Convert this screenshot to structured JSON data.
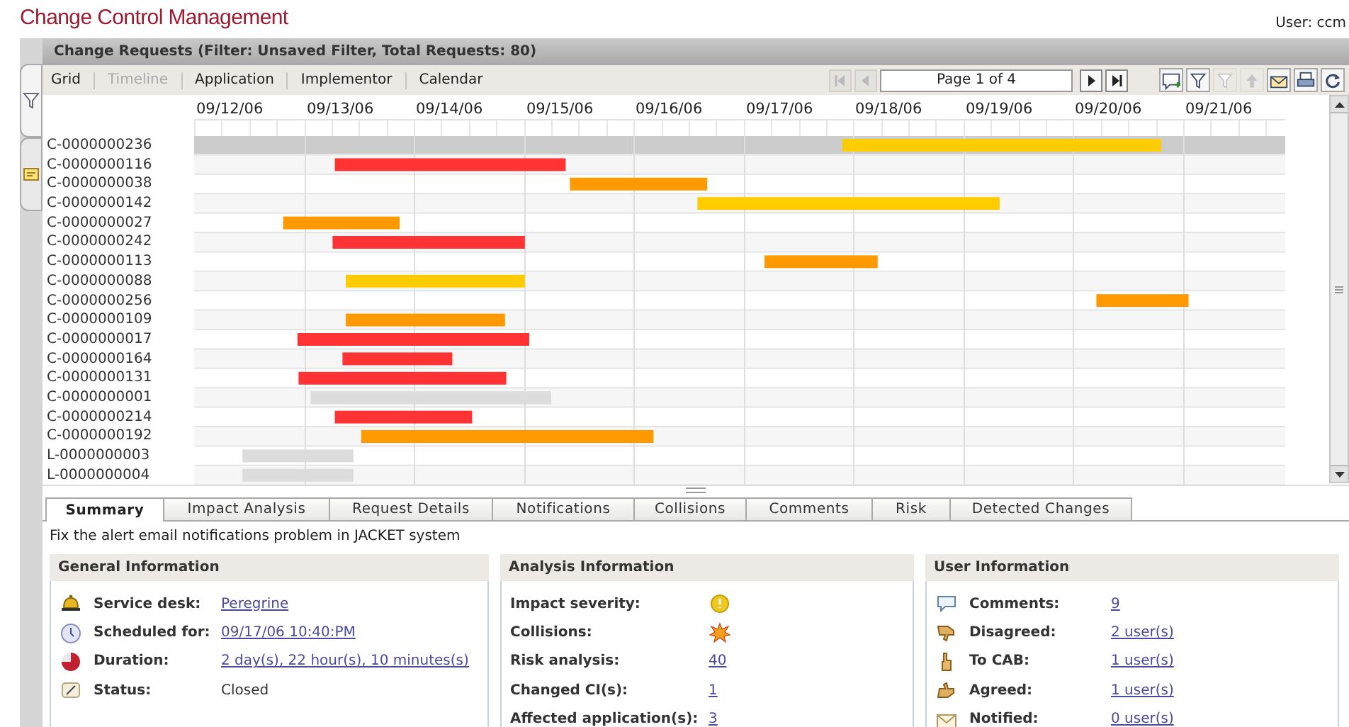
{
  "app_title": "Change Control Management",
  "user": "User: ccm",
  "side_tabs": [
    {
      "kind": "filter",
      "selected": true
    },
    {
      "kind": "note",
      "selected": false
    }
  ],
  "panel_title": "Change Requests (Filter: Unsaved Filter, Total Requests: 80)",
  "views": [
    {
      "label": "Grid",
      "selected": false
    },
    {
      "label": "Timeline",
      "selected": true
    },
    {
      "label": "Application",
      "selected": false
    },
    {
      "label": "Implementor",
      "selected": false
    },
    {
      "label": "Calendar",
      "selected": false
    }
  ],
  "pager": {
    "buttons": [
      {
        "kind": "first",
        "disabled": true
      },
      {
        "kind": "prev",
        "disabled": true
      },
      {
        "kind": "next",
        "disabled": false
      },
      {
        "kind": "last",
        "disabled": false
      }
    ],
    "field": "Page 1 of 4"
  },
  "actions": [
    {
      "kind": "comment",
      "disabled": false
    },
    {
      "kind": "filter",
      "disabled": false
    },
    {
      "kind": "filter",
      "disabled": true
    },
    {
      "kind": "up",
      "disabled": true
    },
    {
      "kind": "mail",
      "disabled": false
    },
    {
      "kind": "print",
      "disabled": false
    },
    {
      "kind": "refresh",
      "disabled": false
    }
  ],
  "gantt": {
    "rows": [
      {
        "id": "C-0000000236",
        "selected": true,
        "color": "#ffcc00"
      },
      {
        "id": "C-0000000116",
        "selected": false,
        "color": "#ff3333"
      },
      {
        "id": "C-0000000038",
        "selected": false,
        "color": "#ff9900"
      },
      {
        "id": "C-0000000142",
        "selected": false,
        "color": "#ffcc00"
      },
      {
        "id": "C-0000000027",
        "selected": false,
        "color": "#ff9900"
      },
      {
        "id": "C-0000000242",
        "selected": false,
        "color": "#ff3333"
      },
      {
        "id": "C-0000000113",
        "selected": false,
        "color": "#ff9900"
      },
      {
        "id": "C-0000000088",
        "selected": false,
        "color": "#ffcc00"
      },
      {
        "id": "C-0000000256",
        "selected": false,
        "color": "#ff9900"
      },
      {
        "id": "C-0000000109",
        "selected": false,
        "color": "#ff9900"
      },
      {
        "id": "C-0000000017",
        "selected": false,
        "color": "#ff3333"
      },
      {
        "id": "C-0000000164",
        "selected": false,
        "color": "#ff3333"
      },
      {
        "id": "C-0000000131",
        "selected": false,
        "color": "#ff3333"
      },
      {
        "id": "C-0000000001",
        "selected": false,
        "color": "#dcdcdc"
      },
      {
        "id": "C-0000000214",
        "selected": false,
        "color": "#ff3333"
      },
      {
        "id": "C-0000000192",
        "selected": false,
        "color": "#ff9900"
      },
      {
        "id": "L-0000000003",
        "selected": false,
        "color": "#dcdcdc"
      },
      {
        "id": "L-0000000004",
        "selected": false,
        "color": "#dcdcdc"
      }
    ],
    "dates": [
      "09/12/06",
      "09/13/06",
      "09/14/06",
      "09/15/06",
      "09/16/06",
      "09/17/06",
      "09/18/06",
      "09/19/06",
      "09/20/06",
      "09/21/06"
    ]
  },
  "tabs": [
    {
      "label": "Summary",
      "selected": true
    },
    {
      "label": "Impact Analysis",
      "selected": false
    },
    {
      "label": "Request Details",
      "selected": false
    },
    {
      "label": "Notifications",
      "selected": false
    },
    {
      "label": "Collisions",
      "selected": false
    },
    {
      "label": "Comments",
      "selected": false
    },
    {
      "label": "Risk",
      "selected": false
    },
    {
      "label": "Detected Changes",
      "selected": false
    }
  ],
  "description": "Fix the alert email notifications problem in JACKET system",
  "sections": [
    {
      "title": "General Information",
      "items": [
        {
          "label": "Service desk:",
          "value": "Peregrine",
          "kind": "link"
        },
        {
          "label": "Scheduled for:",
          "value": "09/17/06 10:40:PM",
          "kind": "link"
        },
        {
          "label": "Duration:",
          "value": "2 day(s), 22 hour(s), 10 minutes(s)",
          "kind": "link"
        },
        {
          "label": "Status:",
          "value": "Closed",
          "kind": "text"
        }
      ]
    },
    {
      "title": "Analysis Information",
      "items": [
        {
          "label": "Impact severity:",
          "kind": "icon"
        },
        {
          "label": "Collisions:",
          "kind": "icon"
        },
        {
          "label": "Risk analysis:",
          "value": "40",
          "kind": "link"
        },
        {
          "label": "Changed CI(s):",
          "value": "1",
          "kind": "link"
        },
        {
          "label": "Affected application(s):",
          "value": "3",
          "kind": "link"
        }
      ]
    },
    {
      "title": "User Information",
      "items": [
        {
          "label": "Comments:",
          "value": "9",
          "kind": "link"
        },
        {
          "label": "Disagreed:",
          "value": "2 user(s)",
          "kind": "link"
        },
        {
          "label": "To CAB:",
          "value": "1 user(s)",
          "kind": "link"
        },
        {
          "label": "Agreed:",
          "value": "1 user(s)",
          "kind": "link"
        },
        {
          "label": "Notified:",
          "value": "0 user(s)",
          "kind": "link"
        }
      ]
    }
  ]
}
